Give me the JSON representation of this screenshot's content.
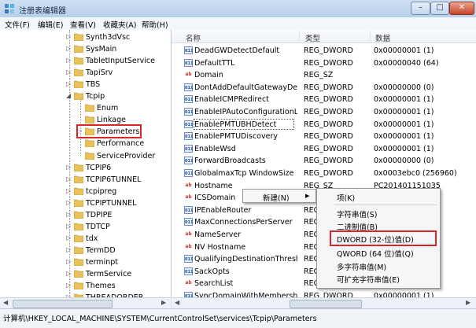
{
  "window": {
    "title": "注册表编辑器",
    "buttons": {
      "minimize": "–",
      "maximize": "□",
      "close": "✕"
    }
  },
  "menubar": [
    "文件(F)",
    "编辑(E)",
    "查看(V)",
    "收藏夹(A)",
    "帮助(H)"
  ],
  "tree": {
    "items": [
      {
        "label": "Synth3dVsc",
        "expander": "▷"
      },
      {
        "label": "SysMain",
        "expander": "▷"
      },
      {
        "label": "TabletInputService",
        "expander": "▷"
      },
      {
        "label": "TapiSrv",
        "expander": "▷"
      },
      {
        "label": "TBS",
        "expander": "▷"
      },
      {
        "label": "Tcpip",
        "expander": "◢"
      },
      {
        "label": "Enum",
        "expander": ""
      },
      {
        "label": "Linkage",
        "expander": ""
      },
      {
        "label": "Parameters",
        "expander": "▷"
      },
      {
        "label": "Performance",
        "expander": ""
      },
      {
        "label": "ServiceProvider",
        "expander": ""
      },
      {
        "label": "TCPIP6",
        "expander": "▷"
      },
      {
        "label": "TCPIP6TUNNEL",
        "expander": "▷"
      },
      {
        "label": "tcpipreg",
        "expander": "▷"
      },
      {
        "label": "TCPIPTUNNEL",
        "expander": "▷"
      },
      {
        "label": "TDPIPE",
        "expander": "▷"
      },
      {
        "label": "TDTCP",
        "expander": "▷"
      },
      {
        "label": "tdx",
        "expander": "▷"
      },
      {
        "label": "TermDD",
        "expander": "▷"
      },
      {
        "label": "terminpt",
        "expander": "▷"
      },
      {
        "label": "TermService",
        "expander": "▷"
      },
      {
        "label": "Themes",
        "expander": "▷"
      },
      {
        "label": "THREADORDER",
        "expander": "▷"
      }
    ]
  },
  "list": {
    "columns": {
      "name": "名称",
      "type": "类型",
      "data": "数据"
    },
    "rows": [
      {
        "icon": "dw",
        "name": "DeadGWDetectDefault",
        "type": "REG_DWORD",
        "data": "0x00000001 (1)"
      },
      {
        "icon": "dw",
        "name": "DefaultTTL",
        "type": "REG_DWORD",
        "data": "0x00000040 (64)"
      },
      {
        "icon": "sz",
        "name": "Domain",
        "type": "REG_SZ",
        "data": ""
      },
      {
        "icon": "dw",
        "name": "DontAddDefaultGatewayDefa...",
        "type": "REG_DWORD",
        "data": "0x00000000 (0)"
      },
      {
        "icon": "dw",
        "name": "EnableICMPRedirect",
        "type": "REG_DWORD",
        "data": "0x00000001 (1)"
      },
      {
        "icon": "dw",
        "name": "EnableIPAutoConfigurationLi...",
        "type": "REG_DWORD",
        "data": "0x00000001 (1)"
      },
      {
        "icon": "dw",
        "name": "EnablePMTUBHDetect",
        "type": "REG_DWORD",
        "data": "0x00000001 (1)"
      },
      {
        "icon": "dw",
        "name": "EnablePMTUDiscovery",
        "type": "REG_DWORD",
        "data": "0x00000001 (1)"
      },
      {
        "icon": "dw",
        "name": "EnableWsd",
        "type": "REG_DWORD",
        "data": "0x00000001 (1)"
      },
      {
        "icon": "dw",
        "name": "ForwardBroadcasts",
        "type": "REG_DWORD",
        "data": "0x00000000 (0)"
      },
      {
        "icon": "dw",
        "name": "GlobalmaxTcp WindowSize",
        "type": "REG_DWORD",
        "data": "0x0003ebc0 (256960)"
      },
      {
        "icon": "sz",
        "name": "Hostname",
        "type": "REG_SZ",
        "data": "PC201401151035"
      },
      {
        "icon": "sz",
        "name": "ICSDomain",
        "type": "REG_SZ",
        "data": ""
      },
      {
        "icon": "dw",
        "name": "IPEnableRouter",
        "type": "REG_DWORD",
        "data": ""
      },
      {
        "icon": "dw",
        "name": "MaxConnectionsPerServer",
        "type": "REG_DWORD",
        "data": ""
      },
      {
        "icon": "sz",
        "name": "NameServer",
        "type": "REG_SZ",
        "data": ""
      },
      {
        "icon": "sz",
        "name": "NV Hostname",
        "type": "REG_SZ",
        "data": ""
      },
      {
        "icon": "dw",
        "name": "QualifyingDestinationThresh...",
        "type": "REG_DWORD",
        "data": ""
      },
      {
        "icon": "dw",
        "name": "SackOpts",
        "type": "REG_DWORD",
        "data": ""
      },
      {
        "icon": "sz",
        "name": "SearchList",
        "type": "REG_SZ",
        "data": ""
      },
      {
        "icon": "dw",
        "name": "SyncDomainWithMembership",
        "type": "REG_DWORD",
        "data": "0x00000001 (1)"
      }
    ]
  },
  "context_menu": {
    "new_label": "新建(N)",
    "arrow": "▶",
    "submenu": [
      "项(K)",
      "字符串值(S)",
      "二进制值(B)",
      "DWORD (32-位)值(D)",
      "QWORD (64 位)值(Q)",
      "多字符串值(M)",
      "可扩充字符串值(E)"
    ]
  },
  "status": {
    "path": "计算机\\HKEY_LOCAL_MACHINE\\SYSTEM\\CurrentControlSet\\services\\Tcpip\\Parameters"
  },
  "colors": {
    "highlight": "#d6262a",
    "folder": "#e8c25a"
  }
}
